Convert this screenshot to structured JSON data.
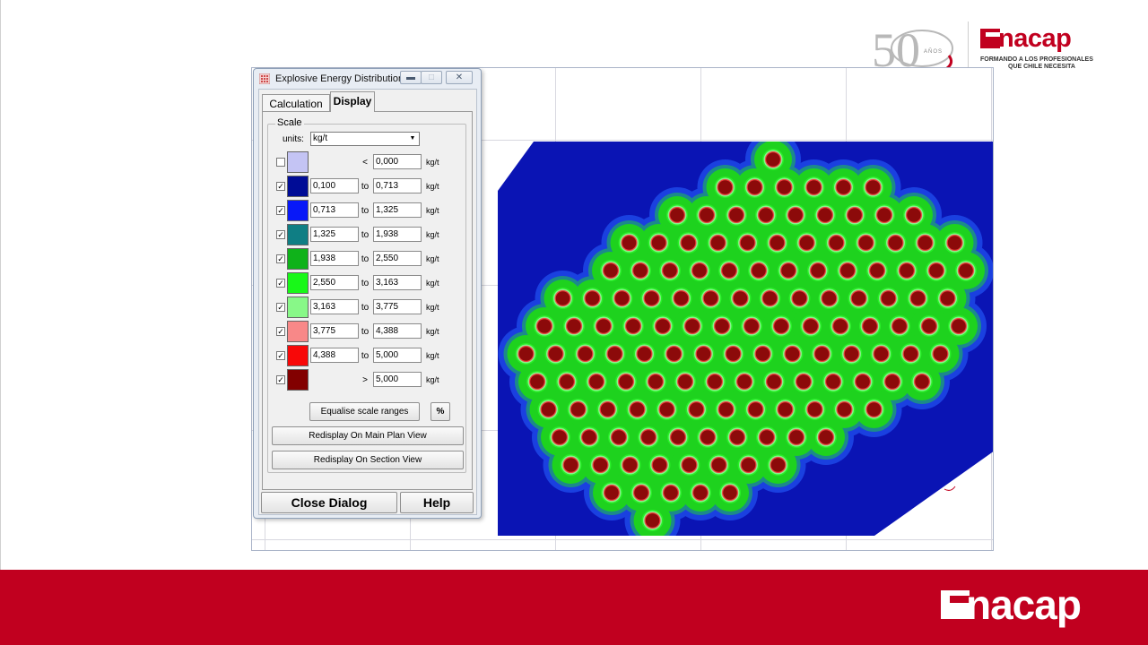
{
  "branding": {
    "anniversary_number": "50",
    "anniversary_word": "AÑOS",
    "brand_name": "nacap",
    "tagline_line1": "FORMANDO A LOS PROFESIONALES",
    "tagline_line2": "QUE CHILE NECESITA",
    "footer_brand": "nacap",
    "brand_color": "#c1001f"
  },
  "dialog": {
    "title": "Explosive Energy Distribution",
    "title_icon": "grid-dots-icon",
    "window_controls": {
      "minimize": "minimize-icon",
      "maximize": "maximize-icon",
      "close": "close-icon"
    },
    "tabs": [
      {
        "label": "Calculation",
        "active": false
      },
      {
        "label": "Display",
        "active": true
      }
    ],
    "scale": {
      "group_label": "Scale",
      "units_label": "units:",
      "units_value": "kg/t",
      "rows": [
        {
          "checked": false,
          "color": "#c4c4f4",
          "from": "",
          "connector": "<",
          "to": "0,000",
          "unit": "kg/t"
        },
        {
          "checked": true,
          "color": "#000c96",
          "from": "0,100",
          "connector": "to",
          "to": "0,713",
          "unit": "kg/t"
        },
        {
          "checked": true,
          "color": "#0818f8",
          "from": "0,713",
          "connector": "to",
          "to": "1,325",
          "unit": "kg/t"
        },
        {
          "checked": true,
          "color": "#0f7e84",
          "from": "1,325",
          "connector": "to",
          "to": "1,938",
          "unit": "kg/t"
        },
        {
          "checked": true,
          "color": "#0fb21a",
          "from": "1,938",
          "connector": "to",
          "to": "2,550",
          "unit": "kg/t"
        },
        {
          "checked": true,
          "color": "#18f818",
          "from": "2,550",
          "connector": "to",
          "to": "3,163",
          "unit": "kg/t"
        },
        {
          "checked": true,
          "color": "#88f888",
          "from": "3,163",
          "connector": "to",
          "to": "3,775",
          "unit": "kg/t"
        },
        {
          "checked": true,
          "color": "#f88888",
          "from": "3,775",
          "connector": "to",
          "to": "4,388",
          "unit": "kg/t"
        },
        {
          "checked": true,
          "color": "#f80808",
          "from": "4,388",
          "connector": "to",
          "to": "5,000",
          "unit": "kg/t"
        },
        {
          "checked": true,
          "color": "#820000",
          "from": "",
          "connector": ">",
          "to": "5,000",
          "unit": "kg/t"
        }
      ]
    },
    "buttons": {
      "equalise": "Equalise scale ranges",
      "percent": "%",
      "redisplay_plan": "Redisplay On Main Plan View",
      "redisplay_section": "Redisplay On Section View",
      "close": "Close Dialog",
      "help": "Help"
    }
  },
  "plot": {
    "colors": {
      "background_region": "#0a14b4",
      "halo_blue": "#1a40e0",
      "halo_teal": "#1c8a8a",
      "fill_green": "#1ed21e",
      "ring_bright": "#28f028",
      "ring_light": "#8cf08c",
      "hole_outer": "#f04040",
      "hole_core": "#8c0a0a"
    }
  }
}
